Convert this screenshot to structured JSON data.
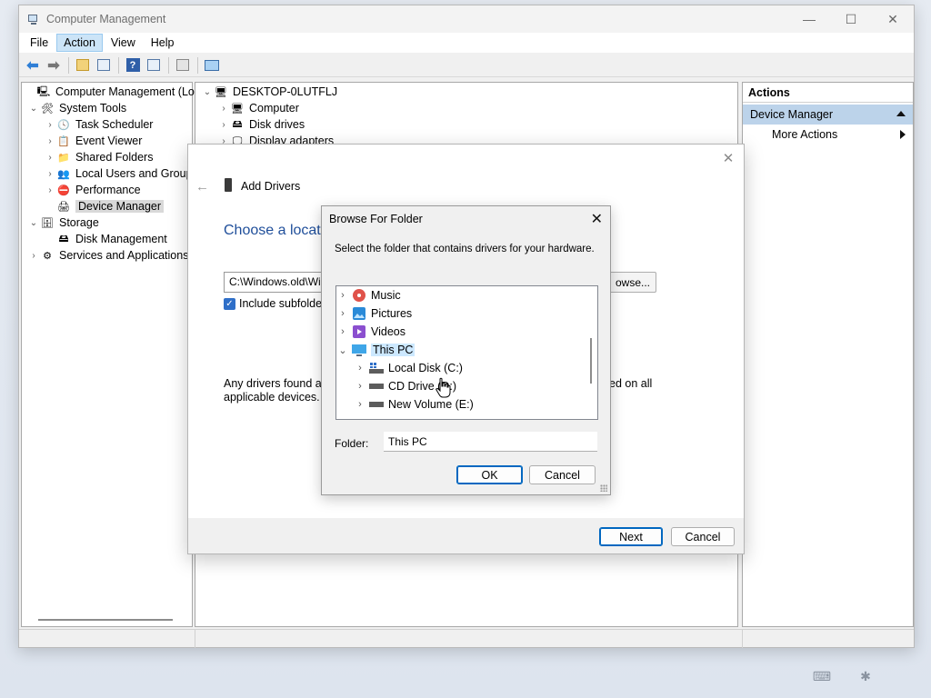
{
  "window": {
    "title": "Computer Management",
    "controls": {
      "minimize": "—",
      "maximize": "☐",
      "close": "✕"
    }
  },
  "menu": [
    "File",
    "Action",
    "View",
    "Help"
  ],
  "menu_active": "Action",
  "tree": {
    "root": "Computer Management (Local",
    "system_tools": "System Tools",
    "task_scheduler": "Task Scheduler",
    "event_viewer": "Event Viewer",
    "shared_folders": "Shared Folders",
    "local_users": "Local Users and Groups",
    "performance": "Performance",
    "device_manager": "Device Manager",
    "storage": "Storage",
    "disk_management": "Disk Management",
    "services": "Services and Applications"
  },
  "devices": {
    "host": "DESKTOP-0LUTFLJ",
    "items": [
      "Computer",
      "Disk drives",
      "Display adapters"
    ]
  },
  "actions": {
    "header": "Actions",
    "section": "Device Manager",
    "more": "More Actions"
  },
  "wizard": {
    "close": "✕",
    "back": "←",
    "title": "Add Drivers",
    "heading": "Choose a locatio",
    "path": "C:\\Windows.old\\Wi",
    "browse": "owse...",
    "include_subfolders": "Include subfolder",
    "text1": "Any drivers found at",
    "text2": "applicable devices.",
    "text3": "ed on all",
    "next": "Next",
    "cancel": "Cancel"
  },
  "browse": {
    "title": "Browse For Folder",
    "description": "Select the folder that contains drivers for your hardware.",
    "items": {
      "music": "Music",
      "pictures": "Pictures",
      "videos": "Videos",
      "this_pc": "This PC",
      "local_disk": "Local Disk (C:)",
      "cd_drive": "CD Drive (D:)",
      "new_volume": "New Volume (E:)"
    },
    "folder_label": "Folder:",
    "folder_value": "This PC",
    "ok": "OK",
    "cancel": "Cancel"
  },
  "colors": {
    "accent": "#0067c0",
    "selection": "#cce8ff",
    "heading": "#1f4e9a"
  }
}
